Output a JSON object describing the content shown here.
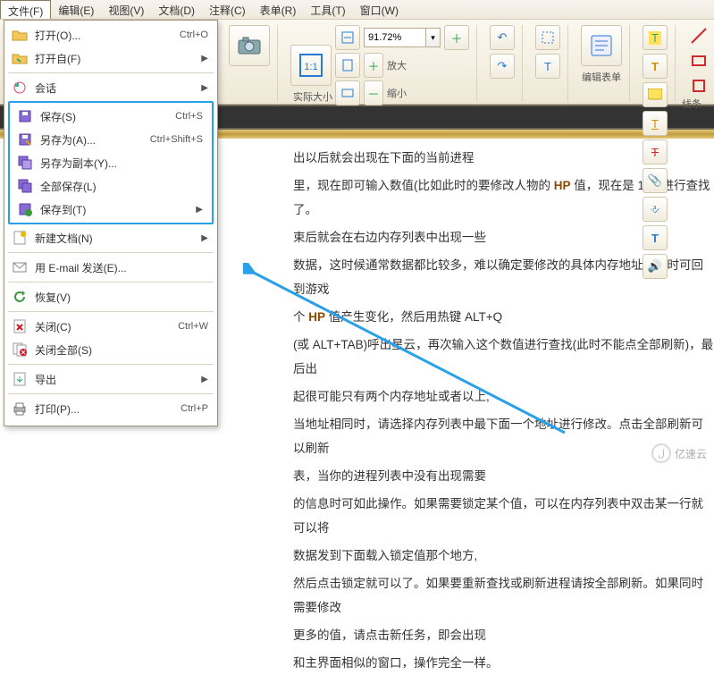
{
  "menubar": {
    "items": [
      {
        "label": "文件(F)"
      },
      {
        "label": "编辑(E)"
      },
      {
        "label": "视图(V)"
      },
      {
        "label": "文档(D)"
      },
      {
        "label": "注释(C)"
      },
      {
        "label": "表单(R)"
      },
      {
        "label": "工具(T)"
      },
      {
        "label": "窗口(W)"
      }
    ]
  },
  "file_menu": {
    "open": {
      "label": "打开(O)...",
      "accel": "Ctrl+O"
    },
    "open_from": {
      "label": "打开自(F)"
    },
    "session": {
      "label": "会话"
    },
    "save": {
      "label": "保存(S)",
      "accel": "Ctrl+S"
    },
    "save_as": {
      "label": "另存为(A)...",
      "accel": "Ctrl+Shift+S"
    },
    "save_copy": {
      "label": "另存为副本(Y)..."
    },
    "save_all": {
      "label": "全部保存(L)"
    },
    "save_to": {
      "label": "保存到(T)"
    },
    "new_doc": {
      "label": "新建文档(N)"
    },
    "email": {
      "label": "用 E-mail 发送(E)..."
    },
    "revert": {
      "label": "恢复(V)"
    },
    "close": {
      "label": "关闭(C)",
      "accel": "Ctrl+W"
    },
    "close_all": {
      "label": "关闭全部(S)"
    },
    "export": {
      "label": "导出"
    },
    "print": {
      "label": "打印(P)...",
      "accel": "Ctrl+P"
    }
  },
  "toolbar": {
    "zoom_value": "91.72%",
    "actual_size": "实际大小",
    "zoom_in": "放大",
    "zoom_out": "缩小",
    "edit_form": "编辑表单",
    "lines": "线条"
  },
  "doc": {
    "p0": "出以后就会出现在下面的当前进程",
    "p1a": "里，现在即可输入数值(比如此时的要修改人物的 ",
    "p1b": " 值，现在是 100)进行查找了。",
    "p2": "束后就会在右边内存列表中出现一些",
    "p3a": "数据，这时候通常数据都比较多，难以确定要修改的具体内存地址。此时可回到游戏",
    "p3b": "个 ",
    "p3c": " 值产生变化，然后用热键 ALT+Q",
    "p4a": "(或 ALT+TAB)呼出星云，再次输入这个数值进行查找(此时不能点全部刷新)，最后出",
    "p4b": "起很可能只有两个内存地址或者以上,",
    "p5a": "当地址相同时，请选择内存列表中最下面一个地址进行修改。点击全部刷新可以刷新",
    "p5b": "表，当你的进程列表中没有出现需要",
    "p6a": "的信息时可如此操作。如果需要锁定某个值，可以在内存列表中双击某一行就可以将",
    "p6b": "数据发到下面载入锁定值那个地方,",
    "p7a": "然后点击锁定就可以了。如果要重新查找或刷新进程请按全部刷新。如果同时需要修改",
    "p7b": "更多的值，请点击新任务，即会出现",
    "p8": "和主界面相似的窗口，操作完全一样。",
    "hp": "HP"
  },
  "watermark": {
    "text": "亿速云"
  }
}
